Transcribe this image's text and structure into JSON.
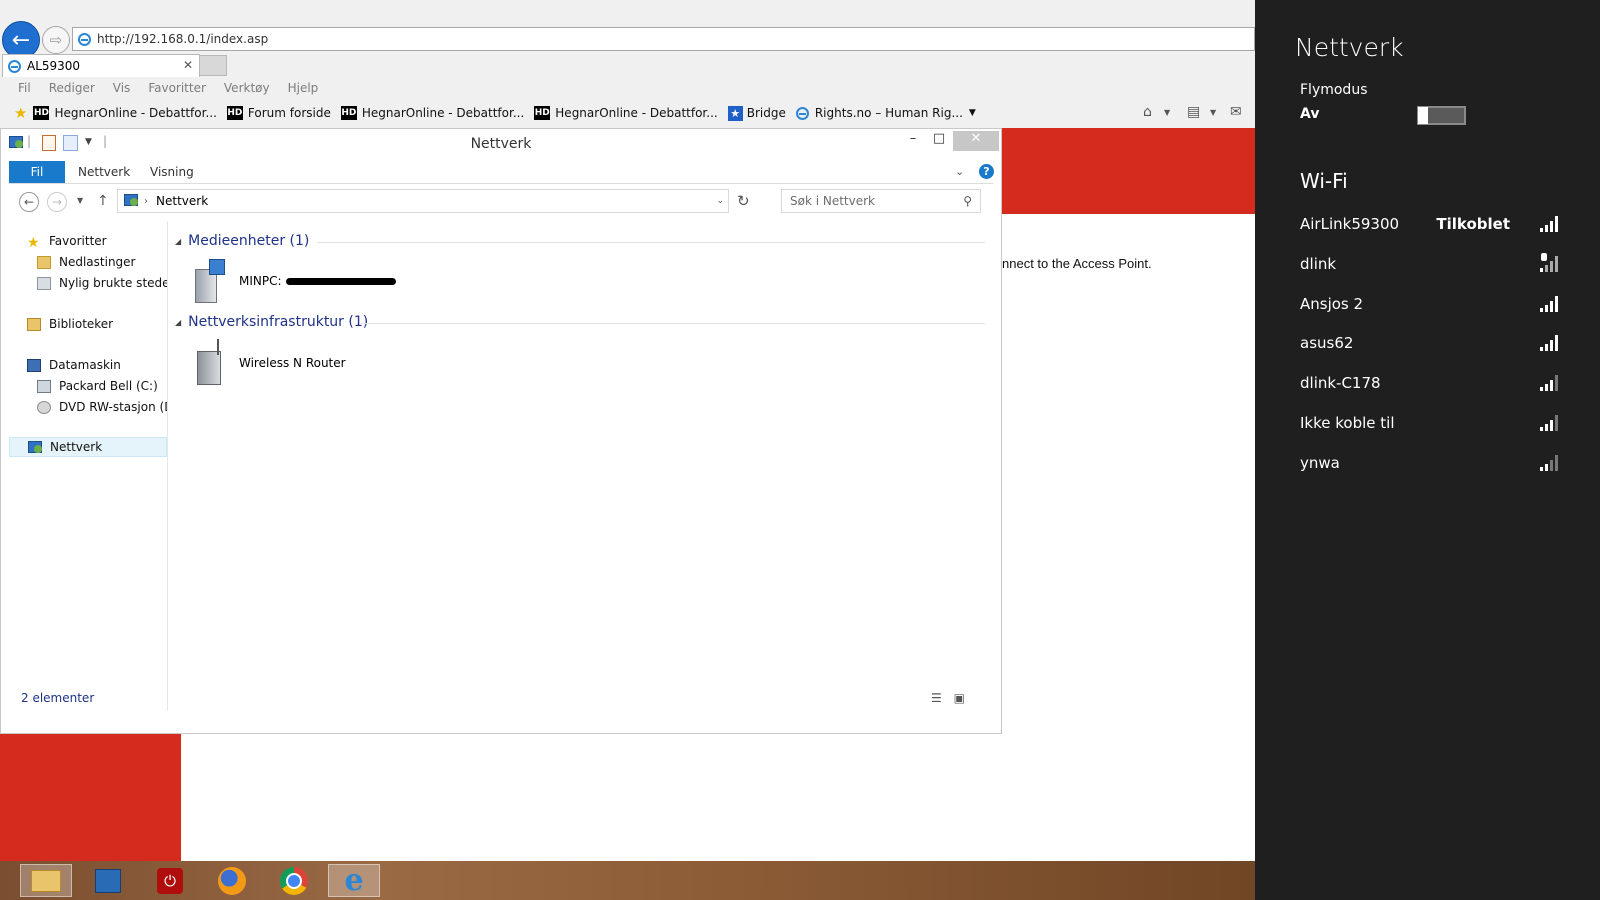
{
  "browser": {
    "url": "http://192.168.0.1/index.asp",
    "tab_title": "AL59300",
    "menu": [
      "Fil",
      "Rediger",
      "Vis",
      "Favoritter",
      "Verktøy",
      "Hjelp"
    ],
    "favorites": [
      {
        "label": "HegnarOnline - Debattfor...",
        "icon": "hd"
      },
      {
        "label": "Forum forside",
        "icon": "hd"
      },
      {
        "label": "HegnarOnline - Debattfor...",
        "icon": "hd"
      },
      {
        "label": "HegnarOnline - Debattfor...",
        "icon": "hd"
      },
      {
        "label": "Bridge",
        "icon": "star"
      },
      {
        "label": "Rights.no – Human Rig...",
        "icon": "ie"
      }
    ]
  },
  "webpage": {
    "visible_text": "nnect to the Access Point."
  },
  "explorer": {
    "title": "Nettverk",
    "ribbon_tabs": [
      "Fil",
      "Nettverk",
      "Visning"
    ],
    "address": "Nettverk",
    "search_placeholder": "Søk i Nettverk",
    "nav": {
      "favorites": "Favoritter",
      "downloads": "Nedlastinger",
      "recent": "Nylig brukte steder",
      "libraries": "Biblioteker",
      "computer": "Datamaskin",
      "drive_c": "Packard Bell (C:)",
      "drive_d": "DVD RW-stasjon (D:)",
      "network": "Nettverk"
    },
    "groups": [
      {
        "title": "Medieenheter (1)",
        "items": [
          {
            "label": "MINPC:"
          }
        ]
      },
      {
        "title": "Nettverksinfrastruktur (1)",
        "items": [
          {
            "label": "Wireless N Router"
          }
        ]
      }
    ],
    "status": "2 elementer"
  },
  "network_pane": {
    "title": "Nettverk",
    "airplane_label": "Flymodus",
    "airplane_state": "Av",
    "wifi_label": "Wi-Fi",
    "networks": [
      {
        "name": "AirLink59300",
        "status": "Tilkoblet",
        "secured": false
      },
      {
        "name": "dlink",
        "status": "",
        "secured": true
      },
      {
        "name": "Ansjos 2",
        "status": "",
        "secured": false
      },
      {
        "name": "asus62",
        "status": "",
        "secured": false
      },
      {
        "name": "dlink-C178",
        "status": "",
        "secured": false
      },
      {
        "name": "Ikke koble til",
        "status": "",
        "secured": false
      },
      {
        "name": "ynwa",
        "status": "",
        "secured": false
      }
    ]
  },
  "taskbar": {
    "apps": [
      "file-explorer-icon",
      "control-panel-icon",
      "shutdown-icon",
      "firefox-icon",
      "chrome-icon",
      "internet-explorer-icon"
    ],
    "active": "internet-explorer-icon"
  },
  "colors": {
    "page_red": "#d52b1e",
    "accent_blue": "#1979ca",
    "pane_bg": "#1f1f1f"
  }
}
